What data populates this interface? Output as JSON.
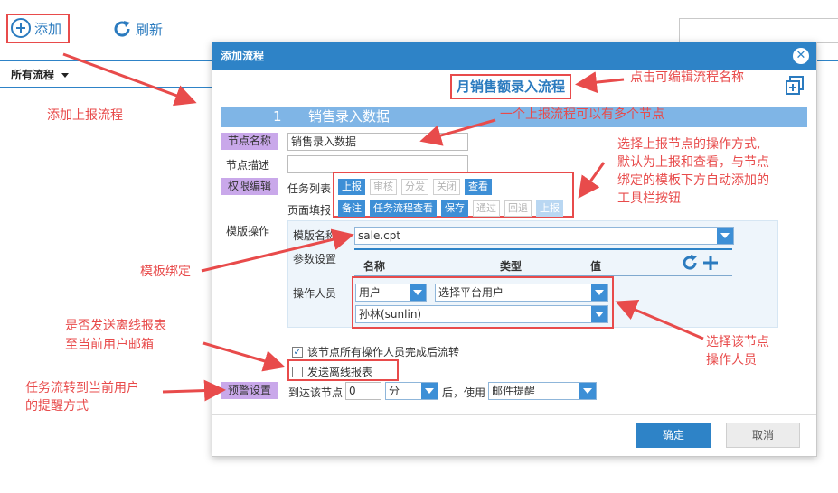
{
  "toolbar": {
    "add_label": "添加",
    "refresh_label": "刷新"
  },
  "tree": {
    "all_flows_label": "所有流程"
  },
  "dialog": {
    "title": "添加流程",
    "flow_name": "月销售额录入流程",
    "node_bar": {
      "number": "1",
      "name": "销售录入数据"
    },
    "node_name_label": "节点名称",
    "node_name_value": "销售录入数据",
    "node_desc_label": "节点描述",
    "node_desc_value": "",
    "permission_label": "权限编辑",
    "task_list_label": "任务列表",
    "task_list_buttons": [
      "上报",
      "审核",
      "分发",
      "关闭",
      "查看"
    ],
    "page_fill_label": "页面填报",
    "page_fill_buttons": [
      "备注",
      "任务流程查看",
      "保存",
      "通过",
      "回退",
      "上报"
    ],
    "template_op_label": "模版操作",
    "template_name_label": "模版名称",
    "template_name_value": "sale.cpt",
    "param_label": "参数设置",
    "param_headers": {
      "name": "名称",
      "type": "类型",
      "value": "值"
    },
    "operator_label": "操作人员",
    "operator_type": "用户",
    "operator_select": "选择平台用户",
    "operator_user": "孙林(sunlin)",
    "flow_after_all_label": "该节点所有操作人员完成后流转",
    "send_offline_label": "发送离线报表",
    "warning_label": "预警设置",
    "arrive_label": "到达该节点",
    "arrive_value": "0",
    "unit_value": "分",
    "after_use_label": "后，使用",
    "remind_value": "邮件提醒",
    "ok_label": "确定",
    "cancel_label": "取消"
  },
  "annotations": {
    "add_flow": "添加上报流程",
    "edit_name": "点击可编辑流程名称",
    "multi_node": "一个上报流程可以有多个节点",
    "op_mode_1": "选择上报节点的操作方式,",
    "op_mode_2": "默认为上报和查看，与节点",
    "op_mode_3": "绑定的模板下方自动添加的",
    "op_mode_4": "工具栏按钮",
    "template_bind": "模板绑定",
    "select_op_1": "选择该节点",
    "select_op_2": "操作人员",
    "offline_1": "是否发送离线报表",
    "offline_2": "至当前用户邮箱",
    "remind_1": "任务流转到当前用户",
    "remind_2": "的提醒方式"
  },
  "colors": {
    "accent": "#2e83c7",
    "annotation": "#e84b4b",
    "label_purple": "#c9a8ea"
  }
}
